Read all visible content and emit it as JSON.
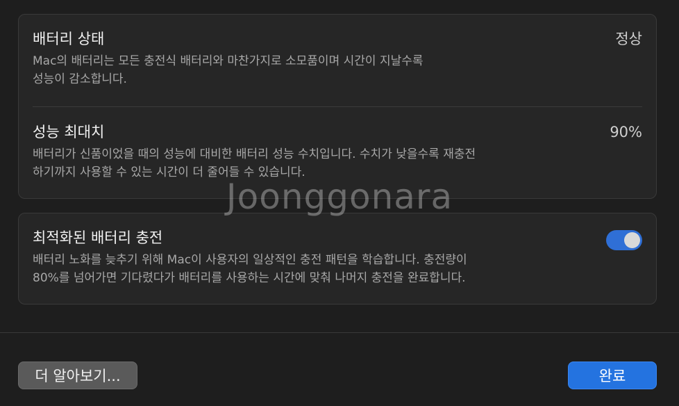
{
  "battery_health": {
    "title": "배터리 상태",
    "value": "정상",
    "description_line1": "Mac의 배터리는 모든 충전식 배터리와 마찬가지로 소모품이며 시간이 지날수록",
    "description_line2": "성능이 감소합니다."
  },
  "max_capacity": {
    "title": "성능 최대치",
    "value": "90%",
    "description_line1": "배터리가 신품이었을 때의 성능에 대비한 배터리 성능 수치입니다. 수치가 낮을수록 재충전",
    "description_line2": "하기까지 사용할 수 있는 시간이 더 줄어들 수 있습니다."
  },
  "optimized_charging": {
    "title": "최적화된 배터리 충전",
    "enabled": true,
    "description_line1": "배터리 노화를 늦추기 위해 Mac이 사용자의 일상적인 충전 패턴을 학습합니다. 충전량이",
    "description_line2": "80%를 넘어가면 기다렸다가 배터리를 사용하는 시간에 맞춰 나머지 충전을 완료합니다."
  },
  "footer": {
    "learn_more_label": "더 알아보기...",
    "done_label": "완료"
  },
  "watermark": "Joonggonara",
  "colors": {
    "accent": "#2473e0",
    "toggle_on": "#2f6fd6",
    "background": "#1e1e1e",
    "panel": "#262626"
  }
}
